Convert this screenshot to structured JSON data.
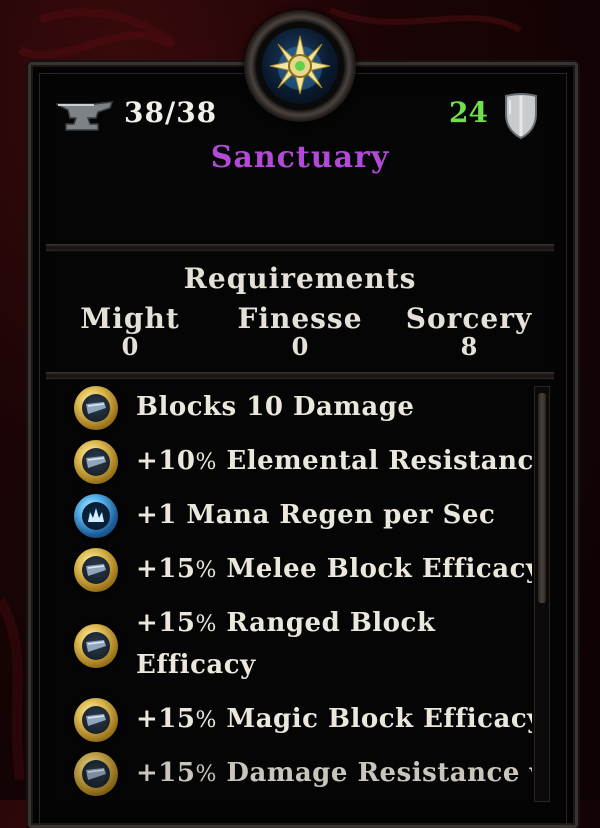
{
  "item": {
    "name": "Sanctuary",
    "durability": "38/38",
    "armor": "24"
  },
  "requirements": {
    "title": "Requirements",
    "stats": [
      {
        "name": "Might",
        "value": "0"
      },
      {
        "name": "Finesse",
        "value": "0"
      },
      {
        "name": "Sorcery",
        "value": "8"
      }
    ]
  },
  "bonuses": [
    {
      "prefix": "Blocks 10 Damage",
      "pct": "",
      "suffix": "",
      "icon": "shield-block-icon"
    },
    {
      "prefix": "+10",
      "pct": "%",
      "suffix": " Elemental Resistance",
      "icon": "shield-block-icon"
    },
    {
      "prefix": "+1 Mana Regen per Sec",
      "pct": "",
      "suffix": "",
      "icon": "mana-regen-icon"
    },
    {
      "prefix": "+15",
      "pct": "%",
      "suffix": " Melee Block Efficacy",
      "icon": "shield-block-icon"
    },
    {
      "prefix": "+15",
      "pct": "%",
      "suffix": " Ranged Block",
      "suffix2": "Efficacy",
      "icon": "shield-block-icon"
    },
    {
      "prefix": "+15",
      "pct": "%",
      "suffix": " Magic Block Efficacy",
      "icon": "shield-block-icon"
    },
    {
      "prefix": "+15",
      "pct": "%",
      "suffix": " Damage Resistance vs",
      "icon": "shield-block-icon"
    }
  ]
}
